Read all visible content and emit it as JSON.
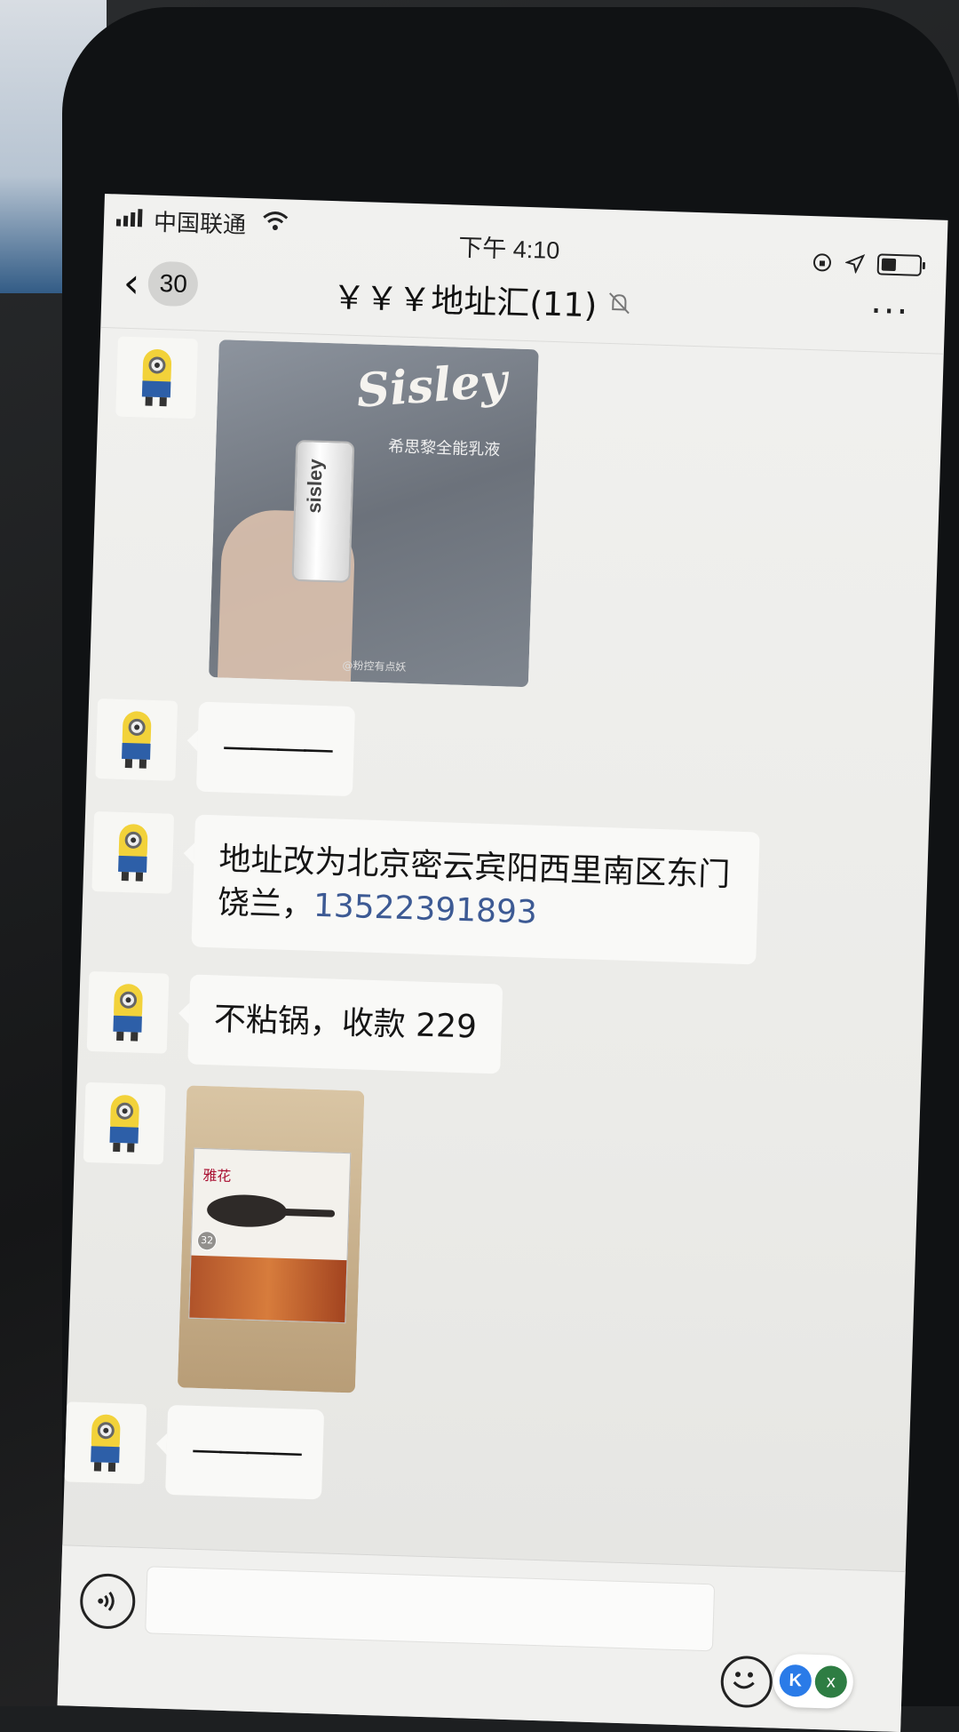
{
  "status_bar": {
    "carrier": "中国联通",
    "time": "下午 4:10"
  },
  "nav": {
    "back_count": "30",
    "title": "￥￥￥地址汇(11)",
    "more": "···"
  },
  "messages": [
    {
      "type": "image",
      "image_text": {
        "brand": "Sisley",
        "subtitle": "希思黎全能乳液",
        "bottle_label": "sisley",
        "watermark": "@粉控有点妖"
      }
    },
    {
      "type": "text",
      "text": "————"
    },
    {
      "type": "text",
      "text_before_link": "地址改为北京密云宾阳西里南区东门饶兰，",
      "link": "13522391893"
    },
    {
      "type": "text",
      "text": "不粘锅，收款 229"
    },
    {
      "type": "image",
      "image_text": {
        "brand": "雅花",
        "badge": "32"
      }
    },
    {
      "type": "text",
      "text": "————"
    }
  ],
  "input_bar": {
    "floating_k": "K",
    "floating_x": "x"
  },
  "colors": {
    "link": "#3d5a94",
    "bubble": "#f9f9f7",
    "screen_bg": "#ecece9"
  },
  "icons": [
    "signal-icon",
    "wifi-icon",
    "orientation-lock-icon",
    "location-icon",
    "battery-icon",
    "back-chevron-icon",
    "mute-bell-icon",
    "more-icon",
    "minion-avatar-icon",
    "voice-icon",
    "emoji-icon"
  ]
}
